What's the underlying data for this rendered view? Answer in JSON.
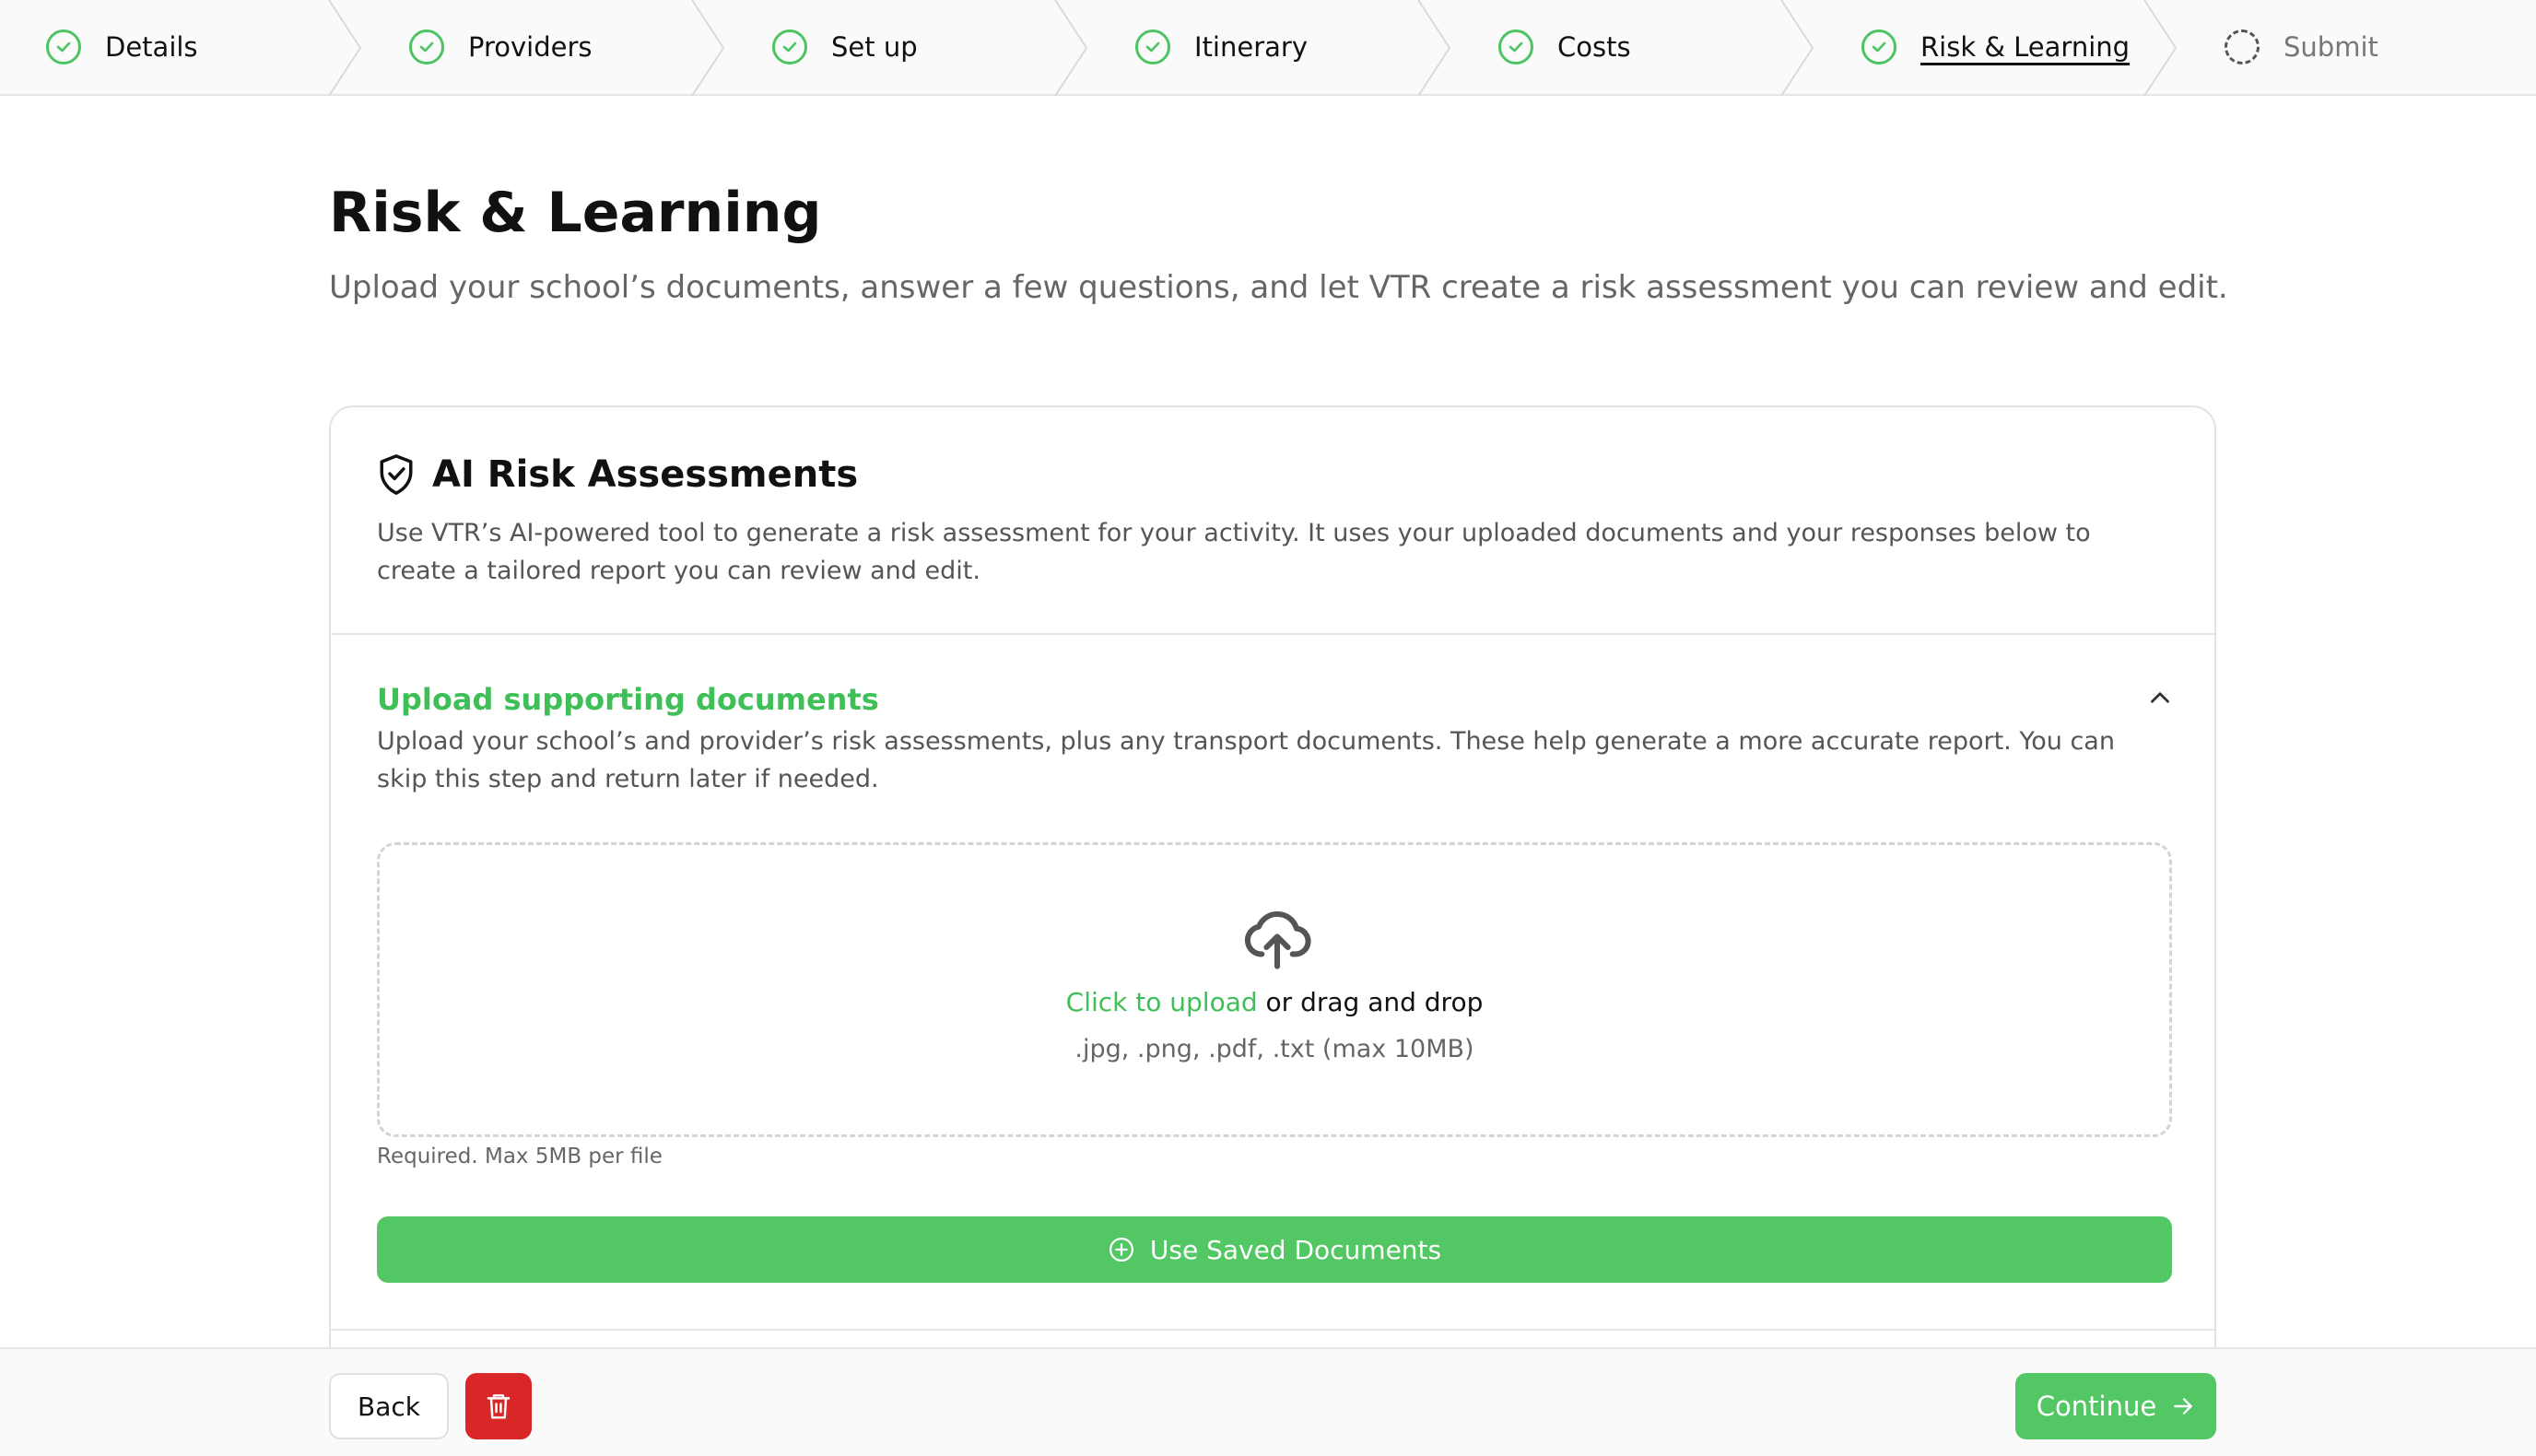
{
  "stepper": {
    "steps": [
      {
        "label": "Details",
        "state": "complete"
      },
      {
        "label": "Providers",
        "state": "complete"
      },
      {
        "label": "Set up",
        "state": "complete"
      },
      {
        "label": "Itinerary",
        "state": "complete"
      },
      {
        "label": "Costs",
        "state": "complete"
      },
      {
        "label": "Risk & Learning",
        "state": "current"
      },
      {
        "label": "Submit",
        "state": "pending"
      }
    ]
  },
  "page": {
    "title": "Risk & Learning",
    "subtitle": "Upload your school’s documents, answer a few questions, and let VTR create a risk assessment you can review and edit."
  },
  "card": {
    "icon": "shield-check-icon",
    "title": "AI Risk Assessments",
    "description": "Use VTR’s AI-powered tool to generate a risk assessment for your activity. It uses your uploaded documents and your responses below to create a tailored report you can review and edit."
  },
  "upload_section": {
    "title": "Upload supporting documents",
    "description": "Upload your school’s and provider’s risk assessments, plus any transport documents. These help generate a more accurate report. You can skip this step and return later if needed.",
    "dropzone": {
      "link_text": "Click to upload",
      "rest_text": " or drag and drop",
      "types_text": ".jpg, .png, .pdf, .txt (max 10MB)"
    },
    "hint": "Required. Max 5MB per file",
    "saved_button_label": "Use Saved Documents"
  },
  "footer": {
    "back_label": "Back",
    "continue_label": "Continue"
  },
  "colors": {
    "accent_green": "#52c764",
    "danger_red": "#d92626"
  }
}
